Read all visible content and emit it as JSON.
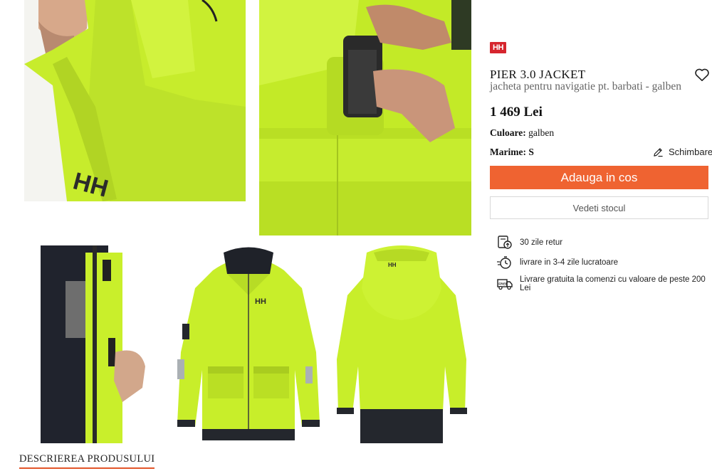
{
  "brand": {
    "logo_text": "HH",
    "color": "#d6262e"
  },
  "product": {
    "name": "PIER 3.0 JACKET",
    "subtitle": "jacheta pentru navigatie pt. barbati - galben",
    "price": "1 469 Lei",
    "color_label": "Culoare:",
    "color_value": "galben",
    "size_label": "Marime:",
    "size_value": "S",
    "change_label": "Schimbare"
  },
  "actions": {
    "add_to_cart": "Adauga in cos",
    "check_stock": "Vedeti stocul",
    "accent_color": "#ef6331"
  },
  "features": [
    {
      "icon": "return-box-icon",
      "text": "30 zile retur"
    },
    {
      "icon": "fast-delivery-icon",
      "text": "livrare in 3-4 zile lucratoare"
    },
    {
      "icon": "free-shipping-truck-icon",
      "text": "Livrare gratuita la comenzi cu valoare de peste 200 Lei"
    }
  ],
  "gallery": [
    {
      "icon": "jacket-hood-closeup-image"
    },
    {
      "icon": "jacket-cuff-closeup-image"
    },
    {
      "icon": "jacket-interior-image"
    },
    {
      "icon": "jacket-front-image"
    },
    {
      "icon": "jacket-back-image"
    }
  ],
  "section": {
    "description_tab": "DESCRIEREA PRODUSULUI"
  },
  "jacket_color": "#c8ee2a"
}
